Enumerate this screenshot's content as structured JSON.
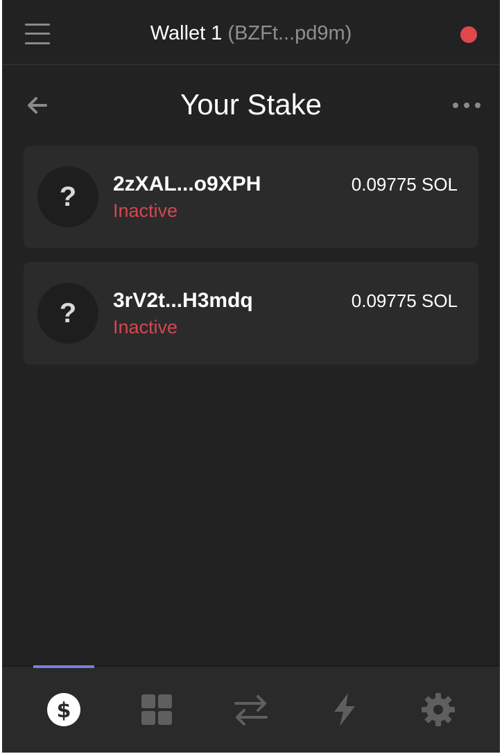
{
  "header": {
    "wallet_name": "Wallet 1",
    "wallet_address": "(BZFt...pd9m)",
    "connection_status_color": "#e0474c",
    "menu_icon": "hamburger-menu-icon"
  },
  "page": {
    "title": "Your Stake",
    "back_icon": "arrow-left-icon",
    "more_icon": "more-horizontal-icon"
  },
  "stakes": [
    {
      "account": "2zXAL...o9XPH",
      "status": "Inactive",
      "amount": "0.09775 SOL",
      "avatar_glyph": "?"
    },
    {
      "account": "3rV2t...H3mdq",
      "status": "Inactive",
      "amount": "0.09775 SOL",
      "avatar_glyph": "?"
    }
  ],
  "bottom_nav": {
    "items": [
      {
        "icon": "balances-dollar-icon",
        "active": true
      },
      {
        "icon": "apps-grid-icon",
        "active": false
      },
      {
        "icon": "swap-arrows-icon",
        "active": false
      },
      {
        "icon": "lightning-bolt-icon",
        "active": false
      },
      {
        "icon": "settings-gear-icon",
        "active": false
      }
    ],
    "active_indicator_color": "#7b7be8"
  },
  "colors": {
    "background": "#222222",
    "card": "#2b2b2b",
    "inactive_status": "#d5474f",
    "muted_icon": "#5f5f5f"
  }
}
